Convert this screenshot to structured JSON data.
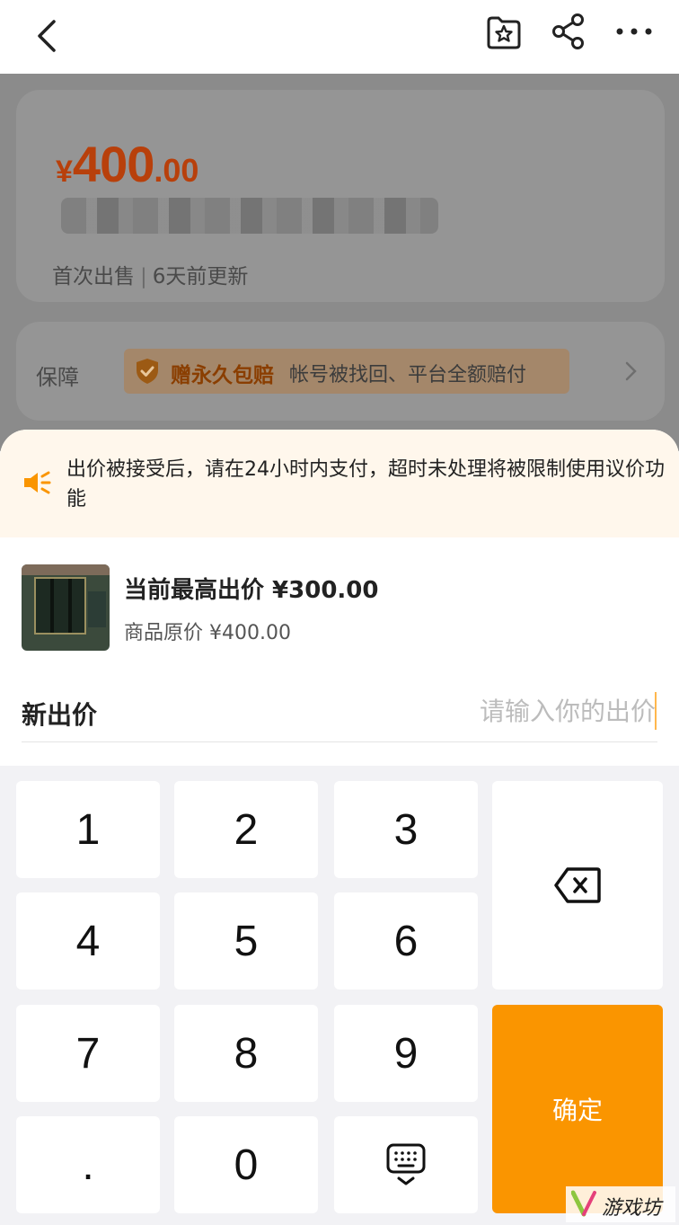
{
  "topbar": {
    "back_icon": "chevron-left-icon",
    "favorite_icon": "star-folder-icon",
    "share_icon": "share-icon",
    "more_icon": "more-dots-icon"
  },
  "listing": {
    "price_currency": "¥",
    "price_integer": "400",
    "price_decimal": ".00",
    "sub_first": "首次出售",
    "sub_sep": "|",
    "sub_updated": "6天前更新",
    "guarantee_label": "保障",
    "guarantee_bold": "赠永久包赔",
    "guarantee_text": "帐号被找回、平台全额赔付"
  },
  "notice": {
    "text": "出价被接受后，请在24小时内支付，超时未处理将被限制使用议价功能"
  },
  "offer": {
    "current_highest": "当前最高出价 ¥300.00",
    "original_price": "商品原价 ¥400.00",
    "new_bid_label": "新出价",
    "new_bid_placeholder": "请输入你的出价"
  },
  "keypad": {
    "k1": "1",
    "k2": "2",
    "k3": "3",
    "k4": "4",
    "k5": "5",
    "k6": "6",
    "k7": "7",
    "k8": "8",
    "k9": "9",
    "kdot": ".",
    "k0": "0",
    "confirm": "确定"
  },
  "watermark": {
    "text": "游戏坊"
  },
  "colors": {
    "accent": "#fa9500",
    "price": "#b8400b",
    "notice_bg": "#fff7ec"
  }
}
